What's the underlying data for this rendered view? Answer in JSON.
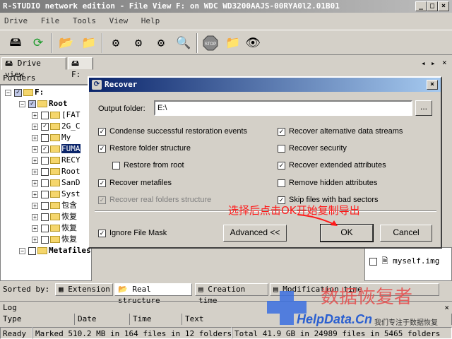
{
  "window": {
    "title": "R-STUDIO network edition - File View F: on WDC WD3200AAJS-00RYA0l2.01B01"
  },
  "menu": [
    "Drive",
    "File",
    "Tools",
    "View",
    "Help"
  ],
  "tabs": [
    {
      "label": "Drive view"
    },
    {
      "label": "F:"
    }
  ],
  "folders_header": "Folders",
  "tree": [
    {
      "label": "F:",
      "level": 0,
      "checked": "partial"
    },
    {
      "label": "Root",
      "level": 1,
      "checked": "partial"
    },
    {
      "label": "[FAT",
      "level": 2,
      "checked": false
    },
    {
      "label": "2G_C",
      "level": 2,
      "checked": true
    },
    {
      "label": "My",
      "level": 2,
      "checked": false
    },
    {
      "label": "FUMA",
      "level": 2,
      "checked": true,
      "selected": true
    },
    {
      "label": "RECY",
      "level": 2,
      "checked": false
    },
    {
      "label": "Root",
      "level": 2,
      "checked": false
    },
    {
      "label": "SanD",
      "level": 2,
      "checked": false
    },
    {
      "label": "Syst",
      "level": 2,
      "checked": false
    },
    {
      "label": "包含",
      "level": 2,
      "checked": false
    },
    {
      "label": "恢复",
      "level": 2,
      "checked": false
    },
    {
      "label": "恢复",
      "level": 2,
      "checked": false
    },
    {
      "label": "恢复",
      "level": 2,
      "checked": false
    },
    {
      "label": "Metafiles",
      "level": 1,
      "checked": false
    }
  ],
  "right_pane": {
    "file": "myself.img"
  },
  "sorted_by": {
    "label": "Sorted by:",
    "options": [
      "Extension",
      "Real structure",
      "Creation time",
      "Modification time"
    ]
  },
  "log": {
    "title": "Log",
    "columns": [
      "Type",
      "Date",
      "Time",
      "Text"
    ]
  },
  "status": {
    "ready": "Ready",
    "marked": "Marked 510.2 MB in 164 files in 12 folders",
    "total": "Total 41.9 GB in 24989 files in 5465 folders"
  },
  "dialog": {
    "title": "Recover",
    "output_folder_label": "Output folder:",
    "output_folder_value": "E:\\",
    "browse_label": "...",
    "left_options": [
      {
        "label": "Condense successful restoration events",
        "checked": true,
        "disabled": false
      },
      {
        "label": "Restore folder structure",
        "checked": true,
        "disabled": false
      },
      {
        "label": "Restore from root",
        "checked": false,
        "disabled": false
      },
      {
        "label": "Recover metafiles",
        "checked": true,
        "disabled": false
      },
      {
        "label": "Recover real folders structure",
        "checked": true,
        "disabled": true
      }
    ],
    "right_options": [
      {
        "label": "Recover alternative data streams",
        "checked": true
      },
      {
        "label": "Recover security",
        "checked": false
      },
      {
        "label": "Recover extended attributes",
        "checked": true
      },
      {
        "label": "Remove hidden attributes",
        "checked": false
      },
      {
        "label": "Skip files with bad sectors",
        "checked": true
      }
    ],
    "ignore_mask": {
      "label": "Ignore File Mask",
      "checked": true
    },
    "advanced_label": "Advanced <<",
    "ok_label": "OK",
    "cancel_label": "Cancel"
  },
  "annotation": "选择后点击OK开始复制导出",
  "watermark": {
    "cn": "数据恢复者",
    "url": "HelpData.Cn",
    "tagline": "我们专注于数据恢复"
  },
  "colors": {
    "accent": "#0a246a",
    "annotation": "#ff1a1a",
    "watermark": "#3a6fe0"
  }
}
